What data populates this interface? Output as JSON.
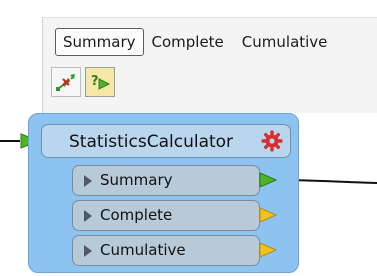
{
  "tabs": {
    "summary": "Summary",
    "complete": "Complete",
    "cumulative": "Cumulative",
    "selected": "Summary"
  },
  "toolbar": {
    "tool1_icon": "connection-tool-icon",
    "tool2_icon": "run-to-here-icon"
  },
  "node": {
    "title": "StatisticsCalculator",
    "gear_icon": "gear-icon",
    "ports": [
      {
        "label": "Summary",
        "arrow_color": "#4fb526"
      },
      {
        "label": "Complete",
        "arrow_color": "#f2c21a"
      },
      {
        "label": "Cumulative",
        "arrow_color": "#f2c21a"
      }
    ]
  },
  "colors": {
    "node_fill": "#8cc3f0",
    "input_port_arrow": "#4fb526",
    "gear": "#d62f2f"
  }
}
